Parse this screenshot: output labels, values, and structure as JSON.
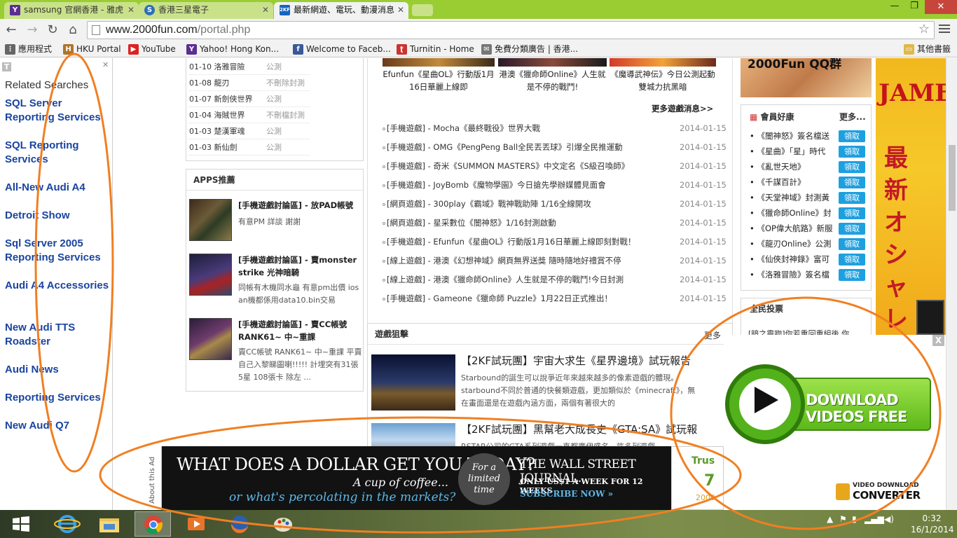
{
  "browser": {
    "tabs": [
      {
        "favicon": "Y",
        "color": "#5b2e91",
        "label": "samsung 官網香港 - 雅虎"
      },
      {
        "favicon": "S",
        "color": "#2e6fb6",
        "label": "香港三星電子"
      },
      {
        "favicon": "2KF",
        "color": "#1565c0",
        "label": "最新網遊、電玩、動漫消息"
      }
    ],
    "url_host": "www.2000fun.com",
    "url_path": "/portal.php",
    "window_controls": {
      "minimize": "—",
      "restore": "❐",
      "close": "✕"
    },
    "bookmarks": [
      {
        "icon": "apps-icon",
        "label": "應用程式"
      },
      {
        "icon": "hku-icon",
        "label": "HKU Portal"
      },
      {
        "icon": "youtube-icon",
        "label": "YouTube"
      },
      {
        "icon": "yahoo-icon",
        "label": "Yahoo! Hong Kon..."
      },
      {
        "icon": "facebook-icon",
        "label": "Welcome to Faceb..."
      },
      {
        "icon": "turnitin-icon",
        "label": "Turnitin - Home"
      },
      {
        "icon": "classified-icon",
        "label": "免費分類廣告 | 香港..."
      },
      {
        "icon": "folder-icon",
        "label": "其他書籤"
      }
    ]
  },
  "left_ad": {
    "title": "Related Searches",
    "links": [
      "SQL Server Reporting Services",
      "SQL Reporting Services",
      "All-New Audi A4",
      "Detroit Show",
      "Sql Server 2005 Reporting Services",
      "Audi A4 Accessories",
      "New Audi TTS Roadster",
      "Audi News",
      "Reporting Services",
      "New Audi Q7"
    ]
  },
  "game_schedule": [
    {
      "date": "01-10",
      "name": "洛雅冒險",
      "status": "公測"
    },
    {
      "date": "01-08",
      "name": "龍刃",
      "status": "不刪除封測"
    },
    {
      "date": "01-07",
      "name": "新劍俠世界",
      "status": "公測"
    },
    {
      "date": "01-04",
      "name": "海賊世界",
      "status": "不刪檔封測"
    },
    {
      "date": "01-03",
      "name": "楚漢軍魂",
      "status": "公測"
    },
    {
      "date": "01-03",
      "name": "新仙劍",
      "status": "公測"
    }
  ],
  "apps": {
    "title": "APPS推薦",
    "items": [
      {
        "title": "[手機遊戲討論區] - 放PAD帳號",
        "desc": "有意PM 詳談 謝謝"
      },
      {
        "title": "[手機遊戲討論區] - 賣monster strike 光神暗騎",
        "desc": "同帳有木機同水龜 有意pm出價 ios an機都係用data10.bin交易"
      },
      {
        "title": "[手機遊戲討論區] - 賣CC帳號 RANK61~ 中~重課",
        "desc": "賣CC帳號 RANK61~ 中~重課 平賣 自己入黎睇圖喇!!!!! 計埋突有31張5星 108張卡 除左 ..."
      }
    ]
  },
  "top_captions": [
    "Efunfun《星曲OL》行動版1月16日華麗上線即",
    "港澳《獵命師Online》人生就是不停的戰鬥!",
    "《魔導武神伝》今日公測起動 雙城力抗黑暗"
  ],
  "more_news": "更多遊戲消息>>",
  "news": [
    {
      "text": "[手機遊戲] - Mocha《最終戰役》世界大戰",
      "date": "2014-01-15"
    },
    {
      "text": "[手機遊戲] - OMG《PengPeng Ball全民丟丟球》引爆全民推運動",
      "date": "2014-01-15"
    },
    {
      "text": "[手機遊戲] - 奇米《SUMMON MASTERS》中文定名《S級召喚師》",
      "date": "2014-01-15"
    },
    {
      "text": "[手機遊戲] - JoyBomb《魔物學園》今日搶先學辦媒體見面會",
      "date": "2014-01-15"
    },
    {
      "text": "[網頁遊戲] - 300play《霸域》戰神戰助陣 1/16全線開攻",
      "date": "2014-01-15"
    },
    {
      "text": "[網頁遊戲] - 星采數位《闇神怒》1/16封測啟動",
      "date": "2014-01-15"
    },
    {
      "text": "[手機遊戲] - Efunfun《星曲OL》行動版1月16日華麗上線即刻對戰！",
      "date": "2014-01-15"
    },
    {
      "text": "[線上遊戲] - 港澳《幻想神域》網頁無界送獎 隨時隨地好禮賞不停",
      "date": "2014-01-15"
    },
    {
      "text": "[線上遊戲] - 港澳《獵命師Online》人生就是不停的戰鬥!今日封測",
      "date": "2014-01-15"
    },
    {
      "text": "[手機遊戲] - Gameone《獵命師 Puzzle》1月22日正式推出！",
      "date": "2014-01-15"
    }
  ],
  "sniper": {
    "title": "遊戲狙擊",
    "more": "更多",
    "items": [
      {
        "title": "【2KF試玩團】宇宙大求生《星界邊境》試玩報告",
        "desc1": "Starbound的誕生可以說爭近年來越來越多的像素遊戲的體現。",
        "desc2": "starbound不同於普通的快餐類遊戲，更加類似於《minecraft》，無",
        "desc3": "在畫面還是在遊戲內涵方面，兩個有著很大的"
      },
      {
        "title": "【2KF試玩團】黑幫老大成長史《GTA:SA》試玩報",
        "desc1": "RSTAR公司的GTA系列遊戲一直都廣伊盛名，許多列遊戲"
      }
    ]
  },
  "qq_banner": "2000Fun QQ群",
  "members": {
    "title": "會員好康",
    "more": "更多...",
    "button": "領取",
    "items": [
      "《闇神怒》簽名檔送",
      "《星曲》「星」時代",
      "《亂世天地》",
      "《千謀百計》",
      "《天堂神域》封測黃",
      "《獵命師Online》封",
      "《OP偉大航路》新服",
      "《龍刃Online》公測",
      "《仙俠封神錄》富可",
      "《洛雅冒險》簽名檔"
    ]
  },
  "vote": {
    "title": "全民投票",
    "text": "[暗之靈吻]你若重回重組後 你"
  },
  "right_ad": {
    "top": "JAME",
    "vertical": "最新オシャレ"
  },
  "download_popup": {
    "label": "DOWNLOAD VIDEOS FREE",
    "brand_top": "VIDEO DOWNLOAD",
    "brand_bottom": "CONVERTER",
    "close": "X"
  },
  "wsj_ad": {
    "about": "About this Ad",
    "headline": "WHAT DOES A DOLLAR GET YOU TODAY?",
    "line2": "A cup of coffee...",
    "line3": "or what's percolating in the markets?",
    "badge": "For a limited time",
    "brand": "THE WALL STREET JOURNAL.",
    "offer": "ONLY US$1 A WEEK FOR 12 WEEKS",
    "cta": "SUBSCRIBE NOW »",
    "side_text": "Trus",
    "side_num": "7",
    "side_year": "2000"
  },
  "taskbar": {
    "time": "0:32",
    "date": "16/1/2014",
    "apps": [
      "start-icon",
      "ie-icon",
      "explorer-icon",
      "chrome-icon",
      "media-icon",
      "firefox-icon",
      "paint-icon"
    ]
  }
}
